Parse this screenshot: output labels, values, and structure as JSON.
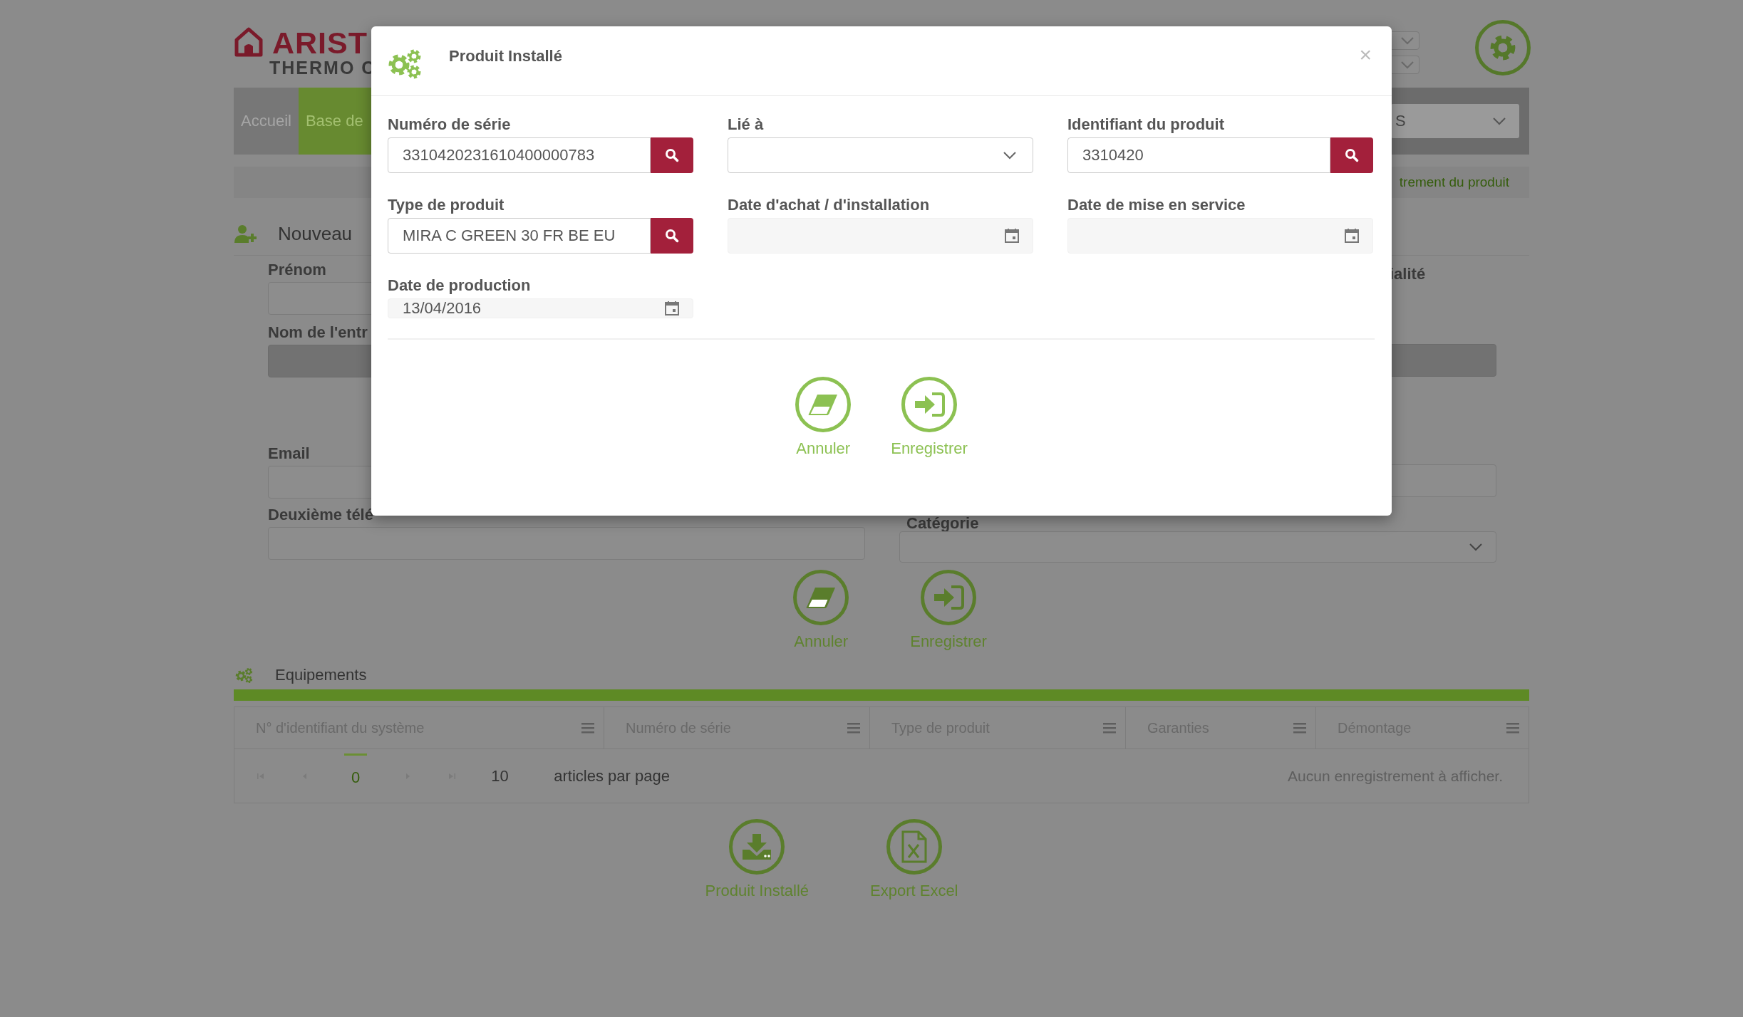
{
  "header": {
    "logo": {
      "line_1": "ARIST",
      "line_2": "THERMO C"
    }
  },
  "nav": {
    "tabs": [
      {
        "label": "Accueil",
        "selected": false
      },
      {
        "label": "Base de",
        "selected": true
      }
    ],
    "dropdown": {
      "value": "S"
    }
  },
  "subbar": {
    "link": "trement du produit"
  },
  "section": {
    "title": "Nouveau"
  },
  "form": {
    "left": [
      {
        "label": "Prénom",
        "disabled": false
      },
      {
        "label": "Nom de l'entr",
        "disabled": true
      },
      {
        "label": "Email",
        "disabled": false
      },
      {
        "label": "Deuxième télé",
        "disabled": false
      }
    ],
    "right": [
      {
        "label": "ialité",
        "kind": "input",
        "disabled": true
      },
      {
        "kind": "input",
        "disabled": false
      },
      {
        "label": "Catégorie",
        "kind": "select",
        "disabled": false
      }
    ]
  },
  "form_actions": [
    {
      "label": "Annuler",
      "kind": "cancel"
    },
    {
      "label": "Enregistrer",
      "kind": "save"
    }
  ],
  "equipment": {
    "title": "Equipements",
    "columns": [
      "N° d'identifiant du système",
      "Numéro de série",
      "Type de produit",
      "Garanties",
      "Démontage"
    ],
    "pager": {
      "page": "0",
      "page_size": "10",
      "per_page_label": "articles par page",
      "empty_message": "Aucun enregistrement à afficher."
    }
  },
  "bottom_actions": [
    {
      "label": "Produit Installé",
      "kind": "download"
    },
    {
      "label": "Export Excel",
      "kind": "excel"
    }
  ],
  "modal": {
    "title": "Produit Installé",
    "close": "×",
    "fields": [
      {
        "label": "Numéro de série",
        "kind": "search",
        "value": "3310420231610400000783"
      },
      {
        "label": "Lié à",
        "kind": "select"
      },
      {
        "label": "Identifiant du produit",
        "kind": "search",
        "value": "3310420"
      },
      {
        "label": "Type de produit",
        "kind": "search",
        "value": "MIRA C GREEN 30 FR BE EU"
      },
      {
        "label": "Date d'achat / d'installation",
        "kind": "date"
      },
      {
        "label": "Date de mise en service",
        "kind": "date"
      },
      {
        "label": "Date de production",
        "kind": "date",
        "value": "13/04/2016"
      }
    ],
    "actions": [
      {
        "label": "Annuler",
        "kind": "cancel"
      },
      {
        "label": "Enregistrer",
        "kind": "save"
      }
    ]
  }
}
